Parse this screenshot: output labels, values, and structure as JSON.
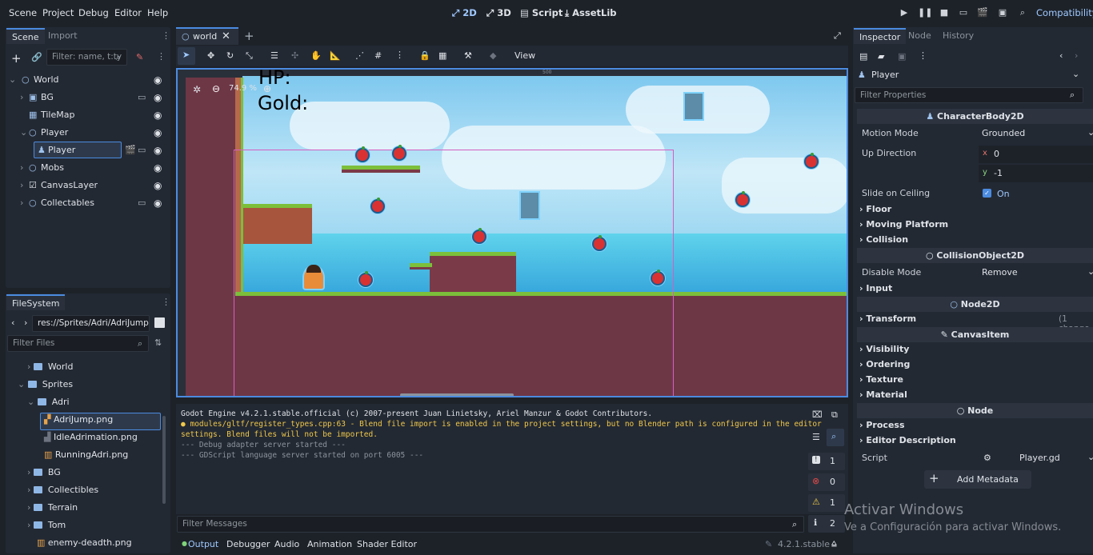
{
  "menu": [
    "Scene",
    "Project",
    "Debug",
    "Editor",
    "Help"
  ],
  "modes": {
    "m2d": "2D",
    "m3d": "3D",
    "script": "Script",
    "assetlib": "AssetLib"
  },
  "renderer": "Compatibility",
  "scene_dock": {
    "tabs": [
      "Scene",
      "Import"
    ],
    "filter_placeholder": "Filter: name, t:ty",
    "nodes": [
      {
        "label": "World"
      },
      {
        "label": "BG"
      },
      {
        "label": "TileMap"
      },
      {
        "label": "Player"
      },
      {
        "label": "Player"
      },
      {
        "label": "Mobs"
      },
      {
        "label": "CanvasLayer"
      },
      {
        "label": "Collectables"
      }
    ]
  },
  "filesystem": {
    "tab": "FileSystem",
    "path": "res://Sprites/Adri/AdriJump.",
    "filter_placeholder": "Filter Files",
    "items": [
      "World",
      "Sprites",
      "Adri",
      "AdriJump.png",
      "IdleAdrimation.png",
      "RunningAdri.png",
      "BG",
      "Collectibles",
      "Terrain",
      "Tom",
      "enemy-deadth.png"
    ]
  },
  "editor_tabs": {
    "active": "world"
  },
  "viewport": {
    "view_label": "View",
    "zoom": "74.9 %",
    "hud_hp": "HP:",
    "hud_gold": "Gold:",
    "ruler_500": "500"
  },
  "console": {
    "lines": [
      "Godot Engine v4.2.1.stable.official (c) 2007-present Juan Linietsky, Ariel Manzur & Godot Contributors.",
      "modules/gltf/register_types.cpp:63 - Blend file import is enabled in the project settings, but no Blender path is configured in the editor",
      "settings. Blend files will not be imported.",
      "--- Debug adapter server started ---",
      "--- GDScript language server started on port 6005 ---"
    ],
    "filter_placeholder": "Filter Messages",
    "counts": {
      "messages": "1",
      "errors": "0",
      "warnings": "1",
      "info": "2"
    }
  },
  "bottom_tabs": [
    "Output",
    "Debugger",
    "Audio",
    "Animation",
    "Shader Editor"
  ],
  "version": "4.2.1.stable",
  "inspector": {
    "tabs": [
      "Inspector",
      "Node",
      "History"
    ],
    "object": "Player",
    "filter_placeholder": "Filter Properties",
    "class_character": "CharacterBody2D",
    "motion_mode_label": "Motion Mode",
    "motion_mode_value": "Grounded",
    "up_direction_label": "Up Direction",
    "up_x_label": "x",
    "up_x": "0",
    "up_y_label": "y",
    "up_y": "-1",
    "slide_label": "Slide on Ceiling",
    "slide_value": "On",
    "groups1": [
      "Floor",
      "Moving Platform",
      "Collision"
    ],
    "class_collision": "CollisionObject2D",
    "disable_mode_label": "Disable Mode",
    "disable_mode_value": "Remove",
    "input_group": "Input",
    "class_node2d": "Node2D",
    "transform_group": "Transform",
    "transform_changes": "(1 change",
    "class_canvasitem": "CanvasItem",
    "groups2": [
      "Visibility",
      "Ordering",
      "Texture",
      "Material"
    ],
    "class_node": "Node",
    "groups3": [
      "Process",
      "Editor Description"
    ],
    "script_label": "Script",
    "script_value": "Player.gd",
    "add_metadata": "Add Metadata"
  },
  "watermark": {
    "line1": "Activar Windows",
    "line2": "Ve a Configuración para activar Windows."
  },
  "colors": {
    "accent": "#4b8be0",
    "bg": "#1d2229",
    "panel": "#232933",
    "sky": "#7ec8ef"
  }
}
